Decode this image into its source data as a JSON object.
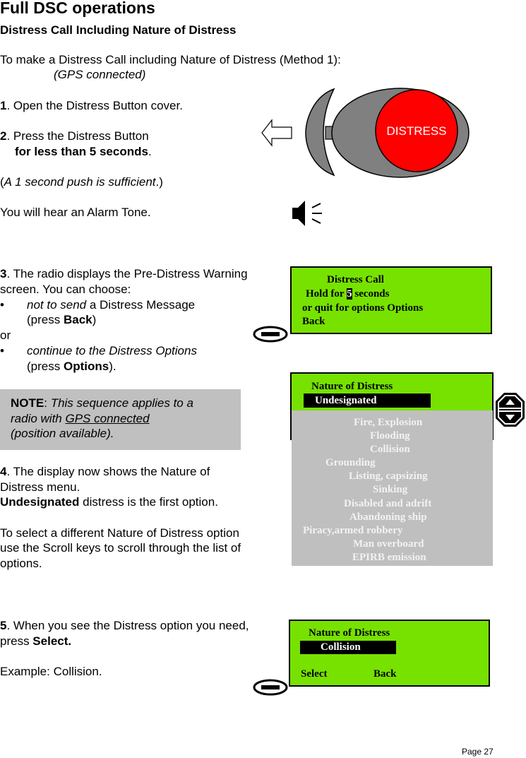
{
  "page": {
    "title": "Full DSC operations",
    "subtitle": "Distress Call Including Nature of Distress",
    "intro": "To make a Distress Call including Nature of Distress (Method 1):",
    "intro_note": "(GPS connected)",
    "page_number": "Page 27"
  },
  "steps": {
    "step1": {
      "num": "1",
      "text": ". Open the Distress Button cover."
    },
    "step2": {
      "num": "2",
      "text": ". Press the Distress Button",
      "bold_line": "for less than 5 seconds",
      "bold_line_end": "."
    },
    "push_note": {
      "open": "(",
      "italic": "A 1 second push is sufficient",
      "close": ".)"
    },
    "alarm": "You will hear an Alarm Tone.",
    "step3": {
      "num": "3",
      "line1": ". The radio displays the Pre-Distress Warning",
      "line2": "screen. You can choose:",
      "bullet1_italic": "not to send",
      "bullet1_rest": " a Distress Message",
      "bullet1_press": "(press ",
      "bullet1_key": "Back",
      "bullet1_close": ")",
      "or": "or",
      "bullet2_italic": "continue to the Distress Options",
      "bullet2_press": "(press ",
      "bullet2_key": "Options",
      "bullet2_close": ").",
      "bullet_glyph": "•"
    },
    "note": {
      "label": "NOTE",
      "colon": ": ",
      "line1": "This sequence applies to a",
      "line2_pre": "radio with ",
      "line2_link": "GPS connected",
      "line3": "(position available)."
    },
    "step4": {
      "num": "4",
      "line1": ". The display now shows the Nature of",
      "line2": "Distress menu.",
      "line3_bold": "Undesignated",
      "line3_rest": " distress is the first option.",
      "para2_line1": "To select a different Nature of Distress option",
      "para2_line2": "use the Scroll keys to scroll through the list of",
      "para2_line3": "options."
    },
    "step5": {
      "num": "5",
      "line1": ". When you see the Distress option you need,",
      "line2_pre": "press ",
      "line2_key": "Select.",
      "example": "Example: Collision."
    }
  },
  "distress_button": {
    "label": "DISTRESS",
    "button_color": "#ff0000",
    "housing_color": "#808080"
  },
  "screens": {
    "pre_distress": {
      "line1": "Distress Call",
      "line2_pre": "Hold for ",
      "line2_count": "5",
      "line2_post": " seconds",
      "line3": "or quit for options Options",
      "line4": "Back",
      "bg_color": "#77e200"
    },
    "nature_menu": {
      "title": "Nature of Distress",
      "selected": "Undesignated",
      "options": [
        "Fire, Explosion",
        "Flooding",
        "Collision",
        "Grounding",
        "Listing, capsizing",
        "Sinking",
        "Disabled and adrift",
        "Abandoning ship",
        "Piracy,armed robbery",
        "Man overboard",
        "EPIRB emission"
      ]
    },
    "nature_selected": {
      "title": "Nature of Distress",
      "selected": "Collision",
      "softkey_left": "Select",
      "softkey_right": "Back"
    }
  }
}
